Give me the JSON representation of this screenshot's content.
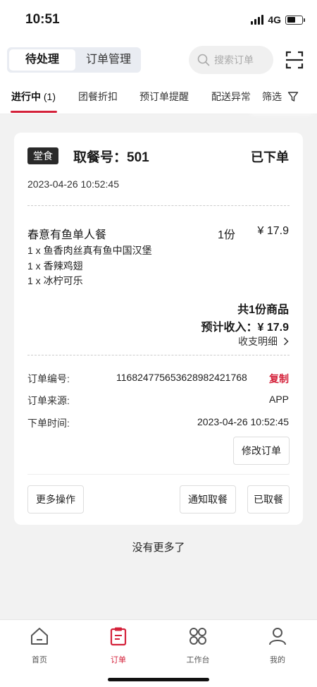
{
  "status_bar": {
    "time": "10:51",
    "network": "4G"
  },
  "header": {
    "segments": [
      "待处理",
      "订单管理"
    ],
    "active_segment": 0,
    "search_placeholder": "搜索订单"
  },
  "tabs": {
    "items": [
      {
        "label": "进行中",
        "count": "(1)"
      },
      {
        "label": "团餐折扣"
      },
      {
        "label": "预订单提醒"
      },
      {
        "label": "配送异常"
      }
    ],
    "filter_label": "筛选"
  },
  "order": {
    "tag": "堂食",
    "pickup_label": "取餐号：501",
    "status": "已下单",
    "time": "2023-04-26 10:52:45",
    "item": {
      "name": "春意有鱼单人餐",
      "qty": "1份",
      "price": "¥ 17.9"
    },
    "sub_items": [
      "1 x 鱼香肉丝真有鱼中国汉堡",
      "1 x 香辣鸡翅",
      "1 x 冰柠可乐"
    ],
    "total_count": "共1份商品",
    "income": "预计收入：¥ 17.9",
    "detail_link": "收支明细",
    "fields": [
      {
        "label": "订单编号:",
        "value": "11682477565362898242176​8"
      },
      {
        "label": "订单来源:",
        "value": "APP"
      },
      {
        "label": "下单时间:",
        "value": "2023-04-26 10:52:45"
      }
    ],
    "copy_label": "复制",
    "buttons": {
      "modify": "修改订单",
      "more": "更多操作",
      "notify": "通知取餐",
      "picked": "已取餐"
    }
  },
  "footer_text": "没有更多了",
  "tabbar": {
    "items": [
      {
        "label": "首页",
        "icon": "home-icon"
      },
      {
        "label": "订单",
        "icon": "clipboard-icon"
      },
      {
        "label": "工作台",
        "icon": "grid-icon"
      },
      {
        "label": "我的",
        "icon": "user-icon"
      }
    ],
    "active": 1
  },
  "colors": {
    "accent": "#d4213a",
    "background": "#f2f2f2"
  }
}
